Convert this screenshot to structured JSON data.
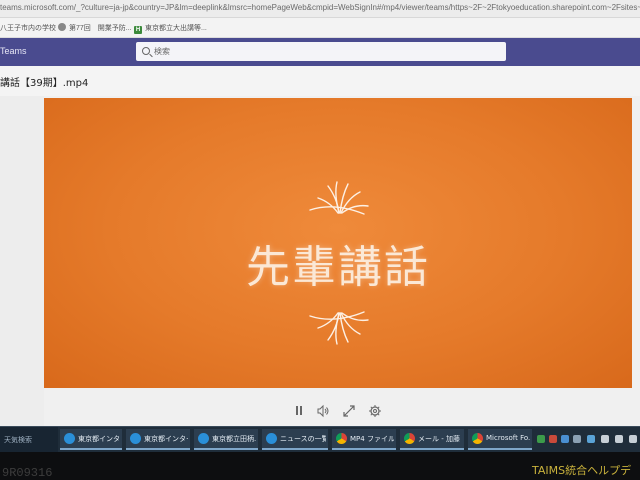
{
  "browser": {
    "url": "teams.microsoft.com/_?culture=ja-jp&country=JP&lm=deeplink&lmsrc=homePageWeb&cmpid=WebSignIn#/mp4/viewer/teams/https~2F~2Ftokyoeducation.sharepoint.com~2Fsites~2F"
  },
  "bookmarks": [
    {
      "label": "八王子市内の学校"
    },
    {
      "label": "第77回　開業予防..."
    },
    {
      "label": "東京都立大出講等..."
    }
  ],
  "teams": {
    "app_name": "Teams",
    "search_placeholder": "検索",
    "accent_color": "#4a4b8f"
  },
  "file": {
    "title": "講話【39期】.mp4"
  },
  "video": {
    "title_text": "先輩講話",
    "background_color": "#e57a2a"
  },
  "controls": {
    "icons": [
      "pause-icon",
      "volume-icon",
      "expand-icon",
      "settings-icon"
    ]
  },
  "taskbar": {
    "start_label": "天気検索",
    "tasks": [
      {
        "label": "東京都インター...",
        "icon": "ie"
      },
      {
        "label": "東京都インター...",
        "icon": "ie"
      },
      {
        "label": "東京都立田柄...",
        "icon": "ie"
      },
      {
        "label": "ニュースの一覧 |...",
        "icon": "ie"
      },
      {
        "label": "MP4 ファイル ビ...",
        "icon": "chrome"
      },
      {
        "label": "メール - 加藤 ...",
        "icon": "chrome"
      },
      {
        "label": "Microsoft Fo...",
        "icon": "chrome"
      }
    ]
  },
  "bezel": {
    "left_text": "9R09316",
    "right_text": "TAIMS統合ヘルプデ"
  }
}
